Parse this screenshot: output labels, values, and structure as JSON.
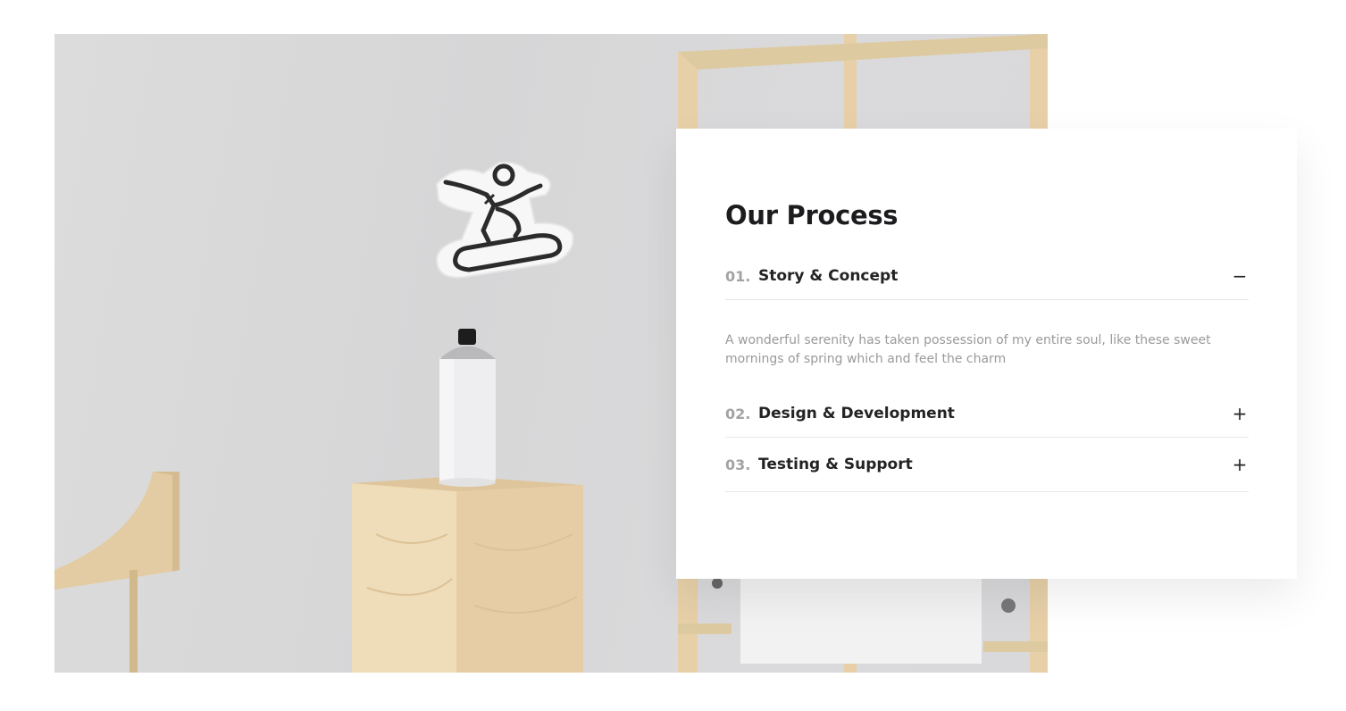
{
  "section": {
    "title": "Our Process"
  },
  "accordion": {
    "items": [
      {
        "number": "01.",
        "title": "Story & Concept",
        "toggle": "−",
        "expanded": true,
        "body": "A wonderful serenity has taken possession of my entire soul, like these sweet mornings of spring which and feel the charm"
      },
      {
        "number": "02.",
        "title": "Design & Development",
        "toggle": "+",
        "expanded": false
      },
      {
        "number": "03.",
        "title": "Testing & Support",
        "toggle": "+",
        "expanded": false
      }
    ]
  },
  "colors": {
    "heading": "#1c1c1e",
    "number": "#a3a3a3",
    "body_text": "#9a9a9a",
    "divider": "#e8e8e8",
    "wood": "#e6cfa7"
  }
}
